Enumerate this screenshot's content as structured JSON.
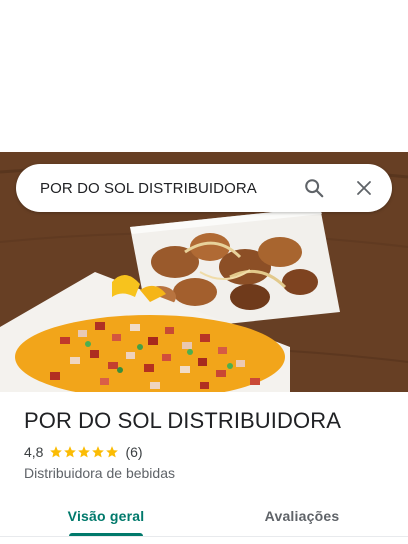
{
  "search": {
    "query": "POR DO SOL DISTRIBUIDORA",
    "search_icon": "search-icon",
    "close_icon": "close-icon"
  },
  "hero": {
    "image": "food-photo"
  },
  "place": {
    "name": "POR DO SOL DISTRIBUIDORA",
    "rating": "4,8",
    "stars": 5,
    "review_count": "(6)",
    "category": "Distribuidora de bebidas"
  },
  "tabs": [
    {
      "label": "Visão geral",
      "active": true
    },
    {
      "label": "Avaliações",
      "active": false
    }
  ],
  "colors": {
    "accent": "#00796b",
    "star": "#fbbc04",
    "text": "#202124",
    "secondary_text": "#5f6368"
  }
}
